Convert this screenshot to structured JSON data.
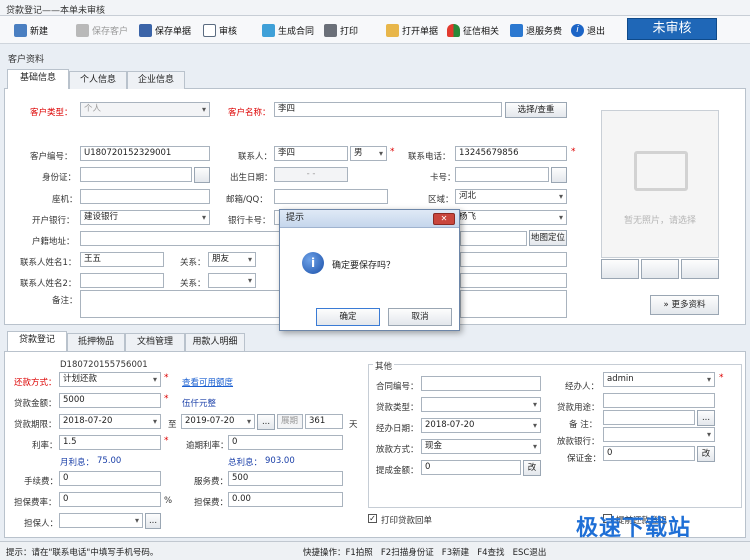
{
  "window": {
    "title": "贷款登记——本单未审核"
  },
  "toolbar": {
    "new": "新建",
    "save_customer": "保存客户",
    "save_form": "保存单据",
    "audit": "审核",
    "gen_contract": "生成合同",
    "print": "打印",
    "open_form": "打开单据",
    "credit": "征信相关",
    "refund_fee": "退服务费",
    "exit": "退出"
  },
  "audit_status": "未审核",
  "customer": {
    "section_title": "客户资料",
    "tabs": [
      "基础信息",
      "个人信息",
      "企业信息"
    ],
    "labels": {
      "type": "客户类型：",
      "name": "客户名称：",
      "code": "客户编号：",
      "contact": "联系人：",
      "phone": "联系电话：",
      "id_card": "身份证：",
      "birthday": "出生日期：",
      "card_no": "卡号：",
      "landline": "座机：",
      "email_qq": "邮箱/QQ：",
      "region": "区域：",
      "bank": "开户银行：",
      "bank_card": "银行卡号：",
      "address": "户籍地址：",
      "contact1": "联系人姓名1：",
      "contact2": "联系人姓名2：",
      "relation1": "关系：",
      "relation2": "关系：",
      "remark": "备注："
    },
    "values": {
      "type": "个人",
      "name": "李四",
      "code": "U180720152329001",
      "contact": "李四",
      "gender": "男",
      "phone": "13245679856",
      "birthday": "- -",
      "region": "河北",
      "bank": "建设银行",
      "staff": "杨飞",
      "contact1": "王五",
      "relation1": "朋友"
    },
    "select_button": "选择/查重",
    "map_button": "地图定位",
    "more_button": "更多资料",
    "photo_placeholder": "暂无照片，请选择"
  },
  "dialog": {
    "title": "提示",
    "message": "确定要保存吗？",
    "ok": "确定",
    "cancel": "取消"
  },
  "loan": {
    "tabs": [
      "贷款登记",
      "抵押物品",
      "文档管理",
      "用款人明细"
    ],
    "doc_no": "D180720155756001",
    "labels": {
      "repay_method": "还款方式：",
      "amount": "贷款金额：",
      "period": "贷款期限：",
      "rate": "利率：",
      "overdue_rate": "逾期利率：",
      "monthly_interest_label": "月利息：",
      "total_interest_label": "总利息：",
      "handling_fee": "手续费：",
      "service_fee": "服务费：",
      "guarantee_rate": "担保费率：",
      "guarantee_fee": "担保费：",
      "guarantor": "担保人：",
      "to": "至",
      "day": "天",
      "pct": "%"
    },
    "values": {
      "repay_method": "计划还款",
      "amount": "5000",
      "amount_upper": "伍仟元整",
      "start_date": "2018-07-20",
      "end_date": "2019-07-20",
      "extend": "展期",
      "days": "361",
      "rate": "1.5",
      "overdue_rate": "0",
      "monthly_interest": "75.00",
      "total_interest": "903.00",
      "handling_fee": "0",
      "service_fee": "500",
      "guarantee_rate": "0",
      "guarantee_fee": "0.00"
    },
    "quota_link": "查看可用额度"
  },
  "other": {
    "title": "其他",
    "labels": {
      "contract_no": "合同编号：",
      "loan_type": "贷款类型：",
      "manager_date": "经办日期：",
      "disburse_method": "放款方式：",
      "deposit": "提成金额：",
      "manager": "经办人：",
      "purpose": "贷款用途：",
      "note": "备  注：",
      "disburse_bank": "放款银行：",
      "deposit2": "保证金："
    },
    "values": {
      "manager": "admin",
      "manager_date": "2018-07-20",
      "disburse_method": "现金",
      "deposit": "0",
      "deposit2": "0",
      "change": "改"
    },
    "print_checkbox": "打印贷款回单",
    "print_checkbox2": "提前还款登记"
  },
  "statusbar": {
    "hint": "提示：请在\"联系电话\"中填写手机号码。",
    "shortcuts": "快捷操作：F1拍照   F2扫描身份证   F3新建   F4查找   ESC退出"
  },
  "watermark": "极速下载站"
}
